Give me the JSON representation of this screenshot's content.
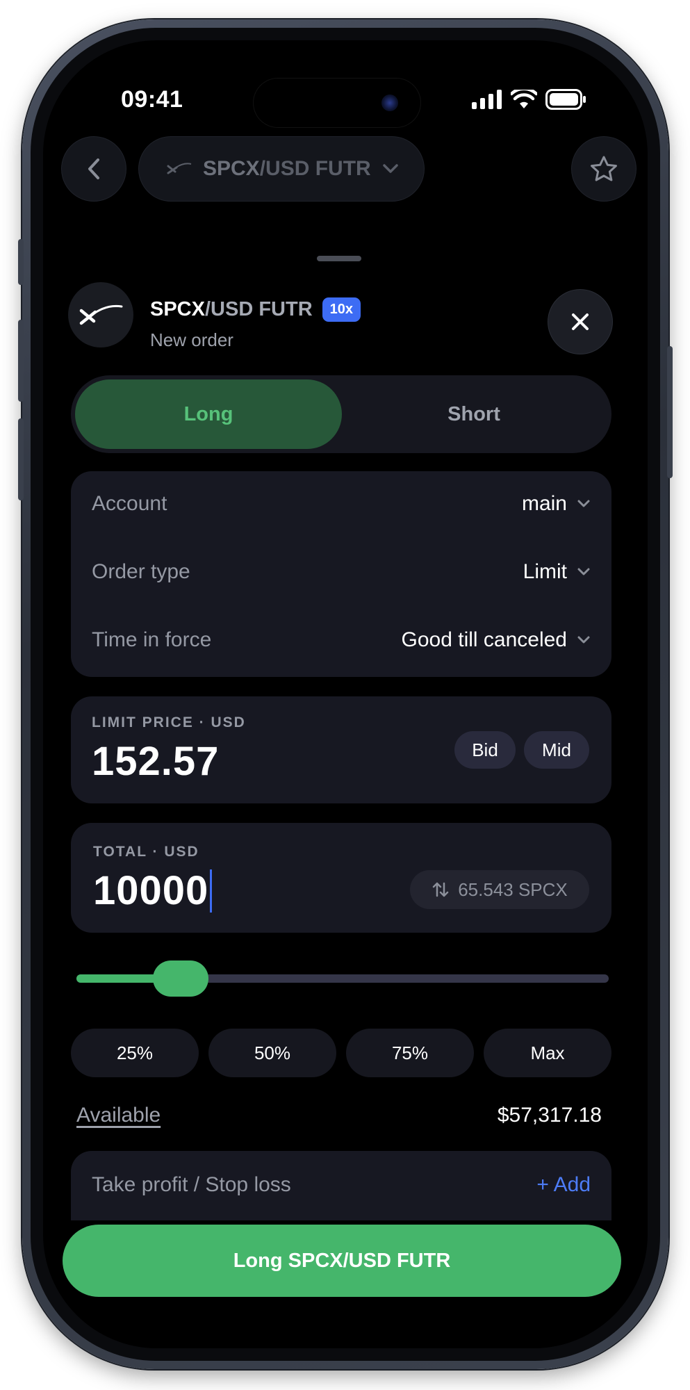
{
  "status_bar": {
    "time": "09:41"
  },
  "nav": {
    "symbol": "SPCX",
    "quote": "/USD FUTR"
  },
  "header": {
    "symbol": "SPCX",
    "quote": "/USD FUTR",
    "leverage": "10x",
    "subtitle": "New order"
  },
  "side_toggle": {
    "long_label": "Long",
    "short_label": "Short",
    "selected": "Long"
  },
  "options": [
    {
      "label": "Account",
      "value": "main"
    },
    {
      "label": "Order type",
      "value": "Limit"
    },
    {
      "label": "Time in force",
      "value": "Good till canceled"
    }
  ],
  "limit_price": {
    "label": "LIMIT PRICE · USD",
    "value": "152.57",
    "bid_label": "Bid",
    "mid_label": "Mid"
  },
  "total": {
    "label": "TOTAL · USD",
    "value": "10000",
    "converted": "65.543 SPCX"
  },
  "slider": {
    "fraction": 0.17
  },
  "percent_buttons": [
    "25%",
    "50%",
    "75%",
    "Max"
  ],
  "available": {
    "label": "Available",
    "value": "$57,317.18"
  },
  "tp_sl": {
    "label": "Take profit / Stop loss",
    "add_label": "+ Add"
  },
  "cta": {
    "label": "Long SPCX/USD FUTR"
  },
  "colors": {
    "accent_green": "#45b66b",
    "accent_blue": "#3d6cf4",
    "background": "#000000"
  }
}
